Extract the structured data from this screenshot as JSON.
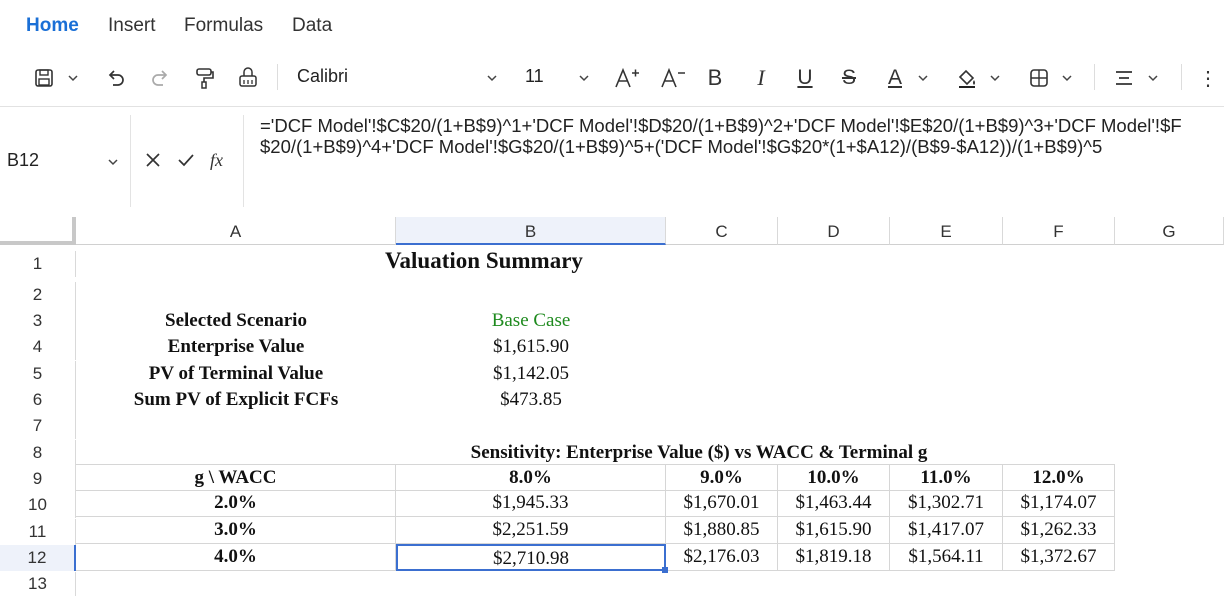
{
  "menu": {
    "home": "Home",
    "insert": "Insert",
    "formulas": "Formulas",
    "data": "Data"
  },
  "toolbar": {
    "font_name": "Calibri",
    "font_size": "11",
    "bold_label": "B",
    "italic_label": "I",
    "underline_label": "U",
    "strike_label": "S",
    "font_color_label": "A",
    "more_label": "⋮"
  },
  "formula_bar": {
    "cell_ref": "B12",
    "fx_label": "fx",
    "formula": "='DCF Model'!$C$20/(1+B$9)^1+'DCF Model'!$D$20/(1+B$9)^2+'DCF Model'!$E$20/(1+B$9)^3+'DCF Model'!$F$20/(1+B$9)^4+'DCF Model'!$G$20/(1+B$9)^5+('DCF Model'!$G$20*(1+$A12)/(B$9-$A12))/(1+B$9)^5"
  },
  "columns": [
    "A",
    "B",
    "C",
    "D",
    "E",
    "F",
    "G"
  ],
  "rows": [
    "1",
    "2",
    "3",
    "4",
    "5",
    "6",
    "7",
    "8",
    "9",
    "10",
    "11",
    "12",
    "13"
  ],
  "sheet": {
    "title": "Valuation Summary",
    "summary": [
      {
        "label": "Selected Scenario",
        "value": "Base Case"
      },
      {
        "label": "Enterprise Value",
        "value": "$1,615.90"
      },
      {
        "label": "PV of Terminal Value",
        "value": "$1,142.05"
      },
      {
        "label": "Sum PV of Explicit FCFs",
        "value": "$473.85"
      }
    ],
    "sensitivity_title": "Sensitivity: Enterprise Value ($) vs WACC & Terminal g",
    "table_header": [
      "g \\ WACC",
      "8.0%",
      "9.0%",
      "10.0%",
      "11.0%",
      "12.0%"
    ],
    "table_rows": [
      [
        "2.0%",
        "$1,945.33",
        "$1,670.01",
        "$1,463.44",
        "$1,302.71",
        "$1,174.07"
      ],
      [
        "3.0%",
        "$2,251.59",
        "$1,880.85",
        "$1,615.90",
        "$1,417.07",
        "$1,262.33"
      ],
      [
        "4.0%",
        "$2,710.98",
        "$2,176.03",
        "$1,819.18",
        "$1,564.11",
        "$1,372.67"
      ]
    ]
  },
  "colors": {
    "accent": "#1a6fd6",
    "selection": "#3b6fd0",
    "scenario_text": "#1e8a1e"
  }
}
